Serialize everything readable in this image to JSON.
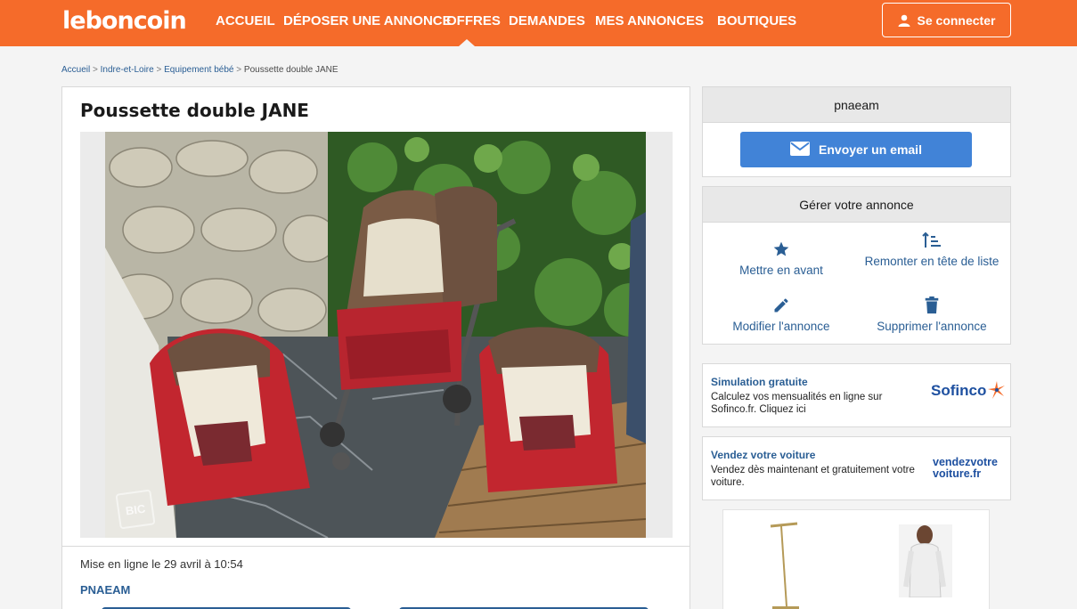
{
  "header": {
    "logo": "leboncoin",
    "nav": [
      "ACCUEIL",
      "DÉPOSER UNE ANNONCE",
      "OFFRES",
      "DEMANDES",
      "MES ANNONCES",
      "BOUTIQUES"
    ],
    "active_nav": "OFFRES",
    "connect_label": "Se connecter"
  },
  "breadcrumb": {
    "items": [
      "Accueil",
      "Indre-et-Loire",
      "Equipement bébé"
    ],
    "current": "Poussette double JANE",
    "separator": ">"
  },
  "ad": {
    "title": "Poussette double JANE",
    "published": "Mise en ligne le 29 avril à 10:54",
    "seller": "PNAEAM",
    "watermark": "BIC"
  },
  "sidebar": {
    "seller_box": {
      "name": "pnaeam",
      "email_button": "Envoyer un email"
    },
    "manage_box": {
      "title": "Gérer votre annonce",
      "actions": [
        {
          "label": "Mettre en avant",
          "icon": "star-icon"
        },
        {
          "label": "Remonter en tête de liste",
          "icon": "sort-up-icon"
        },
        {
          "label": "Modifier l'annonce",
          "icon": "pencil-icon"
        },
        {
          "label": "Supprimer l'annonce",
          "icon": "trash-icon"
        }
      ]
    },
    "promos": [
      {
        "title": "Simulation gratuite",
        "text": "Calculez vos mensualités en ligne sur Sofinco.fr. Cliquez ici",
        "brand": "Sofinco"
      },
      {
        "title": "Vendez votre voiture",
        "text": "Vendez dès maintenant et gratuitement votre voiture.",
        "brand_line1": "vendezvotre",
        "brand_line2": "voiture.fr"
      }
    ]
  },
  "colors": {
    "brand": "#f56b2a",
    "link": "#2a5e94",
    "button": "#4183d7"
  }
}
